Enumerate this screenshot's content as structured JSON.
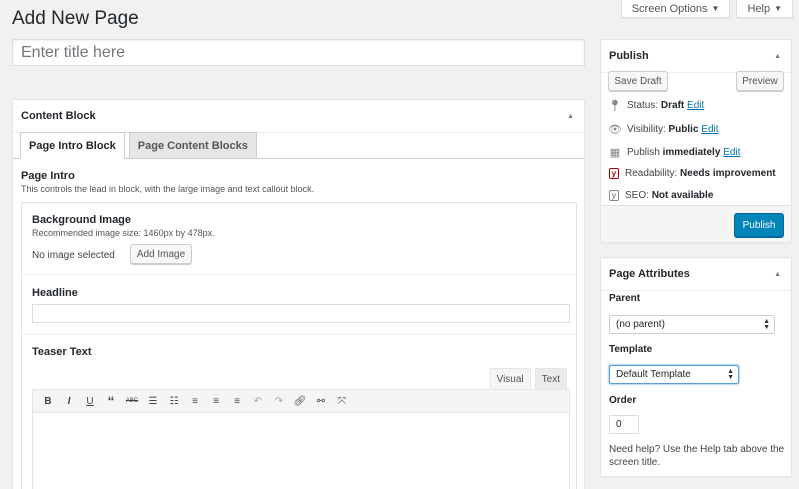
{
  "page": {
    "title": "Add New Page"
  },
  "screen_meta": {
    "screen_options": "Screen Options",
    "help": "Help"
  },
  "title_field": {
    "placeholder": "Enter title here"
  },
  "content_block": {
    "title": "Content Block",
    "tabs": [
      {
        "label": "Page Intro Block",
        "active": true
      },
      {
        "label": "Page Content Blocks",
        "active": false
      }
    ],
    "intro_heading": "Page Intro",
    "intro_desc": "This controls the lead in block, with the large image and text callout block.",
    "background_image": {
      "label": "Background Image",
      "desc": "Recommended image size: 1460px by 478px.",
      "status": "No image selected",
      "button": "Add Image"
    },
    "headline": {
      "label": "Headline",
      "value": ""
    },
    "teaser": {
      "label": "Teaser Text",
      "editor_tabs": [
        "Visual",
        "Text"
      ],
      "toolbar": [
        "bold-icon",
        "italic-icon",
        "underline-icon",
        "blockquote-icon",
        "strikethrough-icon",
        "bullet-list-icon",
        "numbered-list-icon",
        "align-left-icon",
        "align-center-icon",
        "align-right-icon",
        "undo-icon",
        "redo-icon",
        "link-icon",
        "unlink-icon",
        "fullscreen-icon"
      ]
    }
  },
  "publish": {
    "title": "Publish",
    "save_draft": "Save Draft",
    "preview": "Preview",
    "status_label": "Status:",
    "status_value": "Draft",
    "status_edit": "Edit",
    "visibility_label": "Visibility:",
    "visibility_value": "Public",
    "visibility_edit": "Edit",
    "publish_label": "Publish",
    "publish_value": "immediately",
    "publish_edit": "Edit",
    "readability_label": "Readability:",
    "readability_value": "Needs improvement",
    "seo_label": "SEO:",
    "seo_value": "Not available",
    "publish_button": "Publish",
    "colors": {
      "primary": "#0085ba"
    }
  },
  "page_attributes": {
    "title": "Page Attributes",
    "parent_label": "Parent",
    "parent_value": "(no parent)",
    "template_label": "Template",
    "template_value": "Default Template",
    "order_label": "Order",
    "order_value": "0",
    "help_text": "Need help? Use the Help tab above the screen title."
  }
}
